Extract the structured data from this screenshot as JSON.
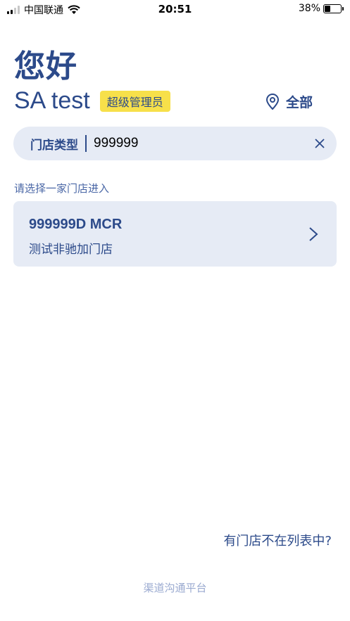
{
  "status_bar": {
    "carrier": "中国联通",
    "time": "20:51",
    "battery_percent": "38%",
    "battery_level": 0.38
  },
  "header": {
    "greeting": "您好",
    "username": "SA test",
    "role": "超级管理员",
    "region": "全部"
  },
  "search": {
    "type_label": "门店类型",
    "value": "999999"
  },
  "hint": "请选择一家门店进入",
  "stores": [
    {
      "code": "999999D MCR",
      "name": "测试非驰加门店"
    }
  ],
  "missing_store_link": "有门店不在列表中?",
  "footer": "渠道沟通平台",
  "colors": {
    "primary": "#2c4a8a",
    "badge": "#f7e04a",
    "panel": "#e6ebf5"
  },
  "icons": [
    "signal-icon",
    "wifi-icon",
    "battery-icon",
    "location-pin-icon",
    "clear-icon",
    "chevron-right-icon"
  ]
}
